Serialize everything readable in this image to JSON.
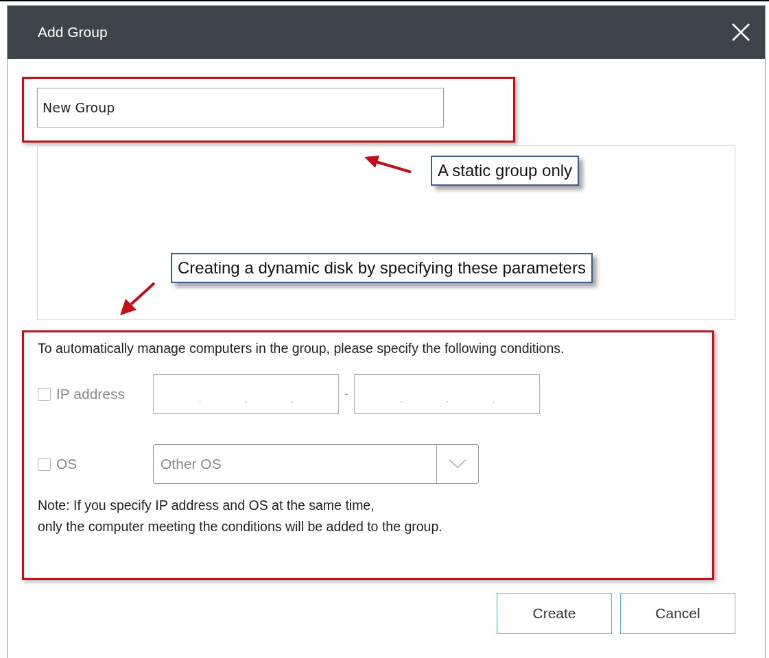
{
  "window": {
    "title": "Add Group"
  },
  "group_name": {
    "value": "New Group"
  },
  "annotations": [
    {
      "text": "A static group only"
    },
    {
      "text": "Creating a dynamic disk by specifying these parameters"
    }
  ],
  "conditions": {
    "intro": "To automatically manage computers in the group, please specify the following conditions.",
    "ip": {
      "label": "IP address",
      "checked": false,
      "disabled": true,
      "fields": [
        {
          "separators": [
            ".",
            ".",
            "."
          ]
        },
        {
          "separators": [
            ".",
            ".",
            "."
          ]
        }
      ],
      "range_separator": "-"
    },
    "os": {
      "label": "OS",
      "checked": false,
      "disabled": true,
      "value": "Other OS"
    },
    "note": [
      "Note: If you specify IP address and OS at the same time,",
      "only the computer meeting the conditions will be added to the group."
    ]
  },
  "buttons": [
    {
      "label": "Create"
    },
    {
      "label": "Cancel"
    }
  ]
}
